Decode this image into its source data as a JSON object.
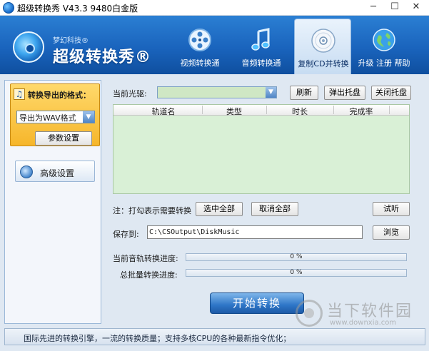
{
  "window": {
    "title": "超级转换秀 V43.3 9480白金版",
    "minimize": "─",
    "maximize": "☐",
    "close": "✕"
  },
  "logo": {
    "company": "梦幻科技®",
    "product": "超级转换秀®"
  },
  "nav": {
    "video": "视频转换通",
    "audio": "音频转换通",
    "cd": "复制CD并转换",
    "upgrade": "升级 注册 帮助"
  },
  "sidebar": {
    "format_title": "转换导出的格式：",
    "format_value": "导出为WAV格式",
    "param_button": "参数设置",
    "advanced_button": "高级设置"
  },
  "main": {
    "drive_label": "当前光驱:",
    "drive_value": "",
    "refresh": "刷新",
    "eject": "弹出托盘",
    "close_tray": "关闭托盘",
    "columns": [
      "轨道名",
      "类型",
      "时长",
      "完成率"
    ],
    "hint": "注：打勾表示需要转换",
    "select_all": "选中全部",
    "deselect_all": "取消全部",
    "listen": "试听",
    "save_label": "保存到:",
    "save_path": "C:\\CSOutput\\DiskMusic",
    "browse": "浏览",
    "track_progress_label": "当前音轨转换进度:",
    "track_progress_value": 0,
    "track_progress_text": "0 %",
    "batch_progress_label": "总批量转换进度:",
    "batch_progress_value": 0,
    "batch_progress_text": "0 %",
    "start": "开始转换"
  },
  "status": {
    "text": "国际先进的转换引擎，一流的转换质量；支持多核CPU的各种最新指令优化；"
  },
  "watermark": {
    "text": "当下软件园",
    "url": "www.downxia.com"
  }
}
